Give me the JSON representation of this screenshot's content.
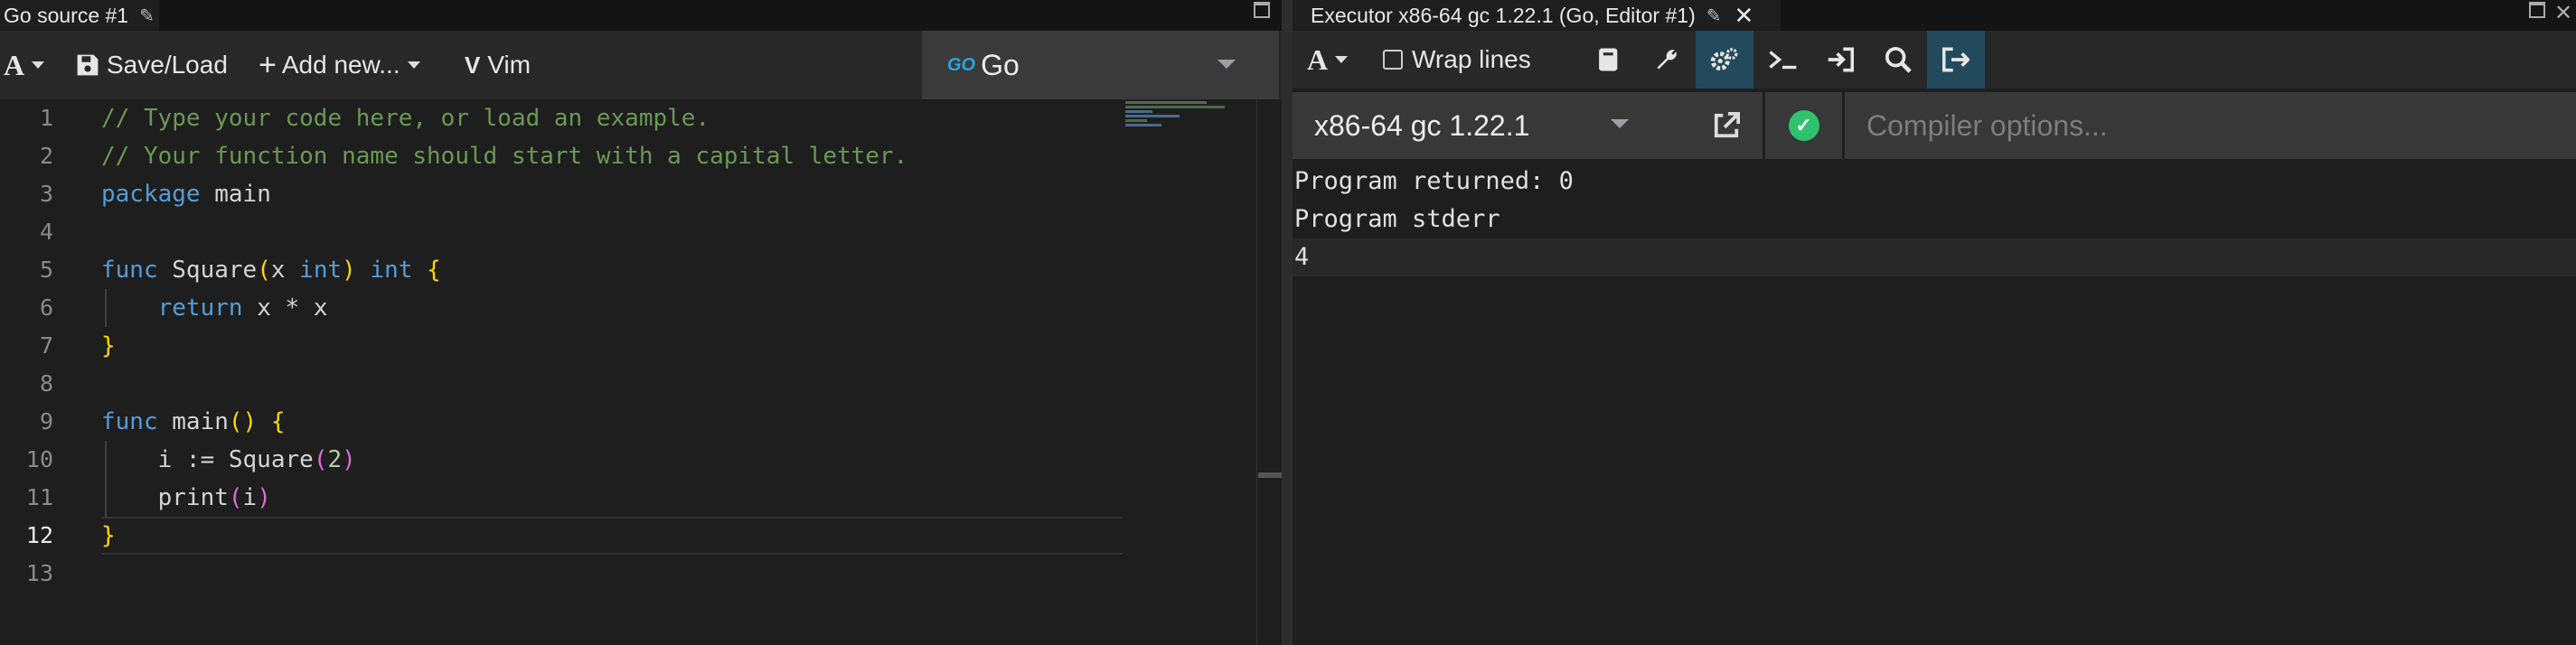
{
  "left_pane": {
    "tab_title": "Go source #1",
    "toolbar": {
      "font_label": "A",
      "save_load_label": "Save/Load",
      "add_new_label": "Add new...",
      "vim_label": "Vim"
    },
    "language": {
      "logo_text": "GO",
      "name": "Go"
    },
    "editor": {
      "line_numbers": [
        "1",
        "2",
        "3",
        "4",
        "5",
        "6",
        "7",
        "8",
        "9",
        "10",
        "11",
        "12",
        "13"
      ],
      "active_line": "12"
    }
  },
  "right_pane": {
    "tab_title": "Executor x86-64 gc 1.22.1 (Go, Editor #1)",
    "toolbar": {
      "font_label": "A",
      "wrap_lines_label": "Wrap lines",
      "icons": [
        "book-icon",
        "wrench-icon",
        "gears-icon",
        "terminal-icon",
        "sign-in-icon",
        "zoom-icon",
        "sign-out-icon"
      ]
    },
    "compiler": {
      "name": "x86-64 gc 1.22.1",
      "options_placeholder": "Compiler options...",
      "status": "success"
    },
    "output": {
      "lines": [
        "Program returned: 0",
        "Program stderr",
        "4"
      ]
    }
  },
  "colors": {
    "background": "#1e1e1e",
    "toolbar": "#282828",
    "active_toggle": "#23495c",
    "success": "#2dc26b",
    "comment": "#6a9955",
    "keyword": "#569cd6",
    "bracket": "#ffd700"
  }
}
